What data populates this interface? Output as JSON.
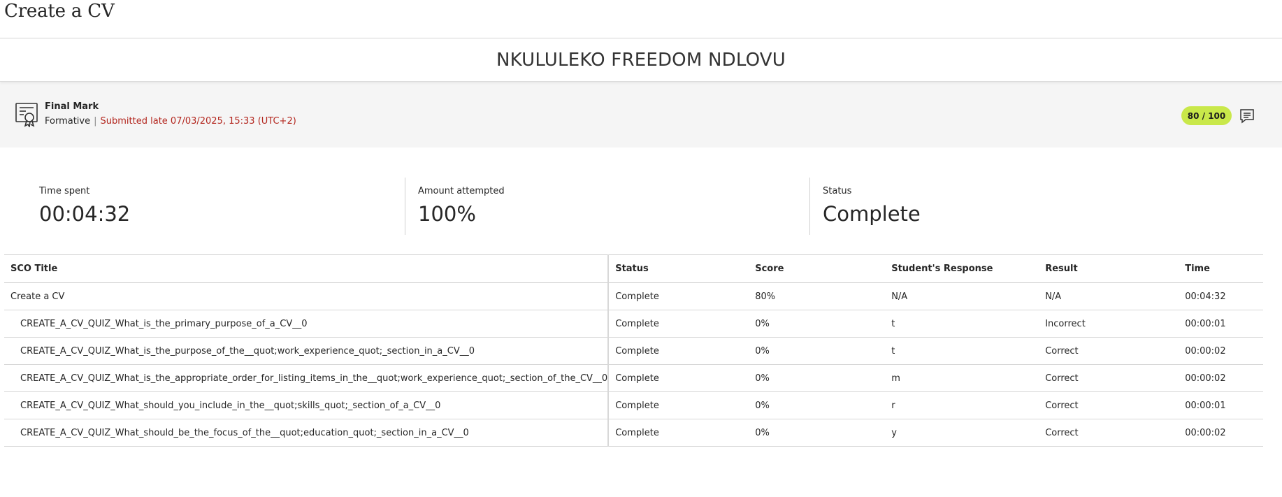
{
  "page": {
    "title": "Create a CV"
  },
  "student": {
    "name": "NKULULEKO FREEDOM NDLOVU"
  },
  "mark": {
    "title": "Final Mark",
    "type": "Formative",
    "submission": "Submitted late 07/03/2025, 15:33 (UTC+2)",
    "score": "80 / 100",
    "icon": "certificate-icon",
    "feedback_icon": "feedback-icon",
    "colors": {
      "score_pill": "#c9e84a",
      "late_text": "#b3261e"
    }
  },
  "stats": [
    {
      "label": "Time spent",
      "value": "00:04:32"
    },
    {
      "label": "Amount attempted",
      "value": "100%"
    },
    {
      "label": "Status",
      "value": "Complete"
    }
  ],
  "table": {
    "headers": [
      "SCO Title",
      "Status",
      "Score",
      "Student's Response",
      "Result",
      "Time"
    ],
    "rows": [
      {
        "title": "Create a CV",
        "status": "Complete",
        "score": "80%",
        "response": "N/A",
        "result": "N/A",
        "time": "00:04:32"
      },
      {
        "title": "CREATE_A_CV_QUIZ_What_is_the_primary_purpose_of_a_CV__0",
        "status": "Complete",
        "score": "0%",
        "response": "t",
        "result": "Incorrect",
        "time": "00:00:01"
      },
      {
        "title": "CREATE_A_CV_QUIZ_What_is_the_purpose_of_the__quot;work_experience_quot;_section_in_a_CV__0",
        "status": "Complete",
        "score": "0%",
        "response": "t",
        "result": "Correct",
        "time": "00:00:02"
      },
      {
        "title": "CREATE_A_CV_QUIZ_What_is_the_appropriate_order_for_listing_items_in_the__quot;work_experience_quot;_section_of_the_CV__0",
        "status": "Complete",
        "score": "0%",
        "response": "m",
        "result": "Correct",
        "time": "00:00:02"
      },
      {
        "title": "CREATE_A_CV_QUIZ_What_should_you_include_in_the__quot;skills_quot;_section_of_a_CV__0",
        "status": "Complete",
        "score": "0%",
        "response": "r",
        "result": "Correct",
        "time": "00:00:01"
      },
      {
        "title": "CREATE_A_CV_QUIZ_What_should_be_the_focus_of_the__quot;education_quot;_section_in_a_CV__0",
        "status": "Complete",
        "score": "0%",
        "response": "y",
        "result": "Correct",
        "time": "00:00:02"
      }
    ]
  }
}
